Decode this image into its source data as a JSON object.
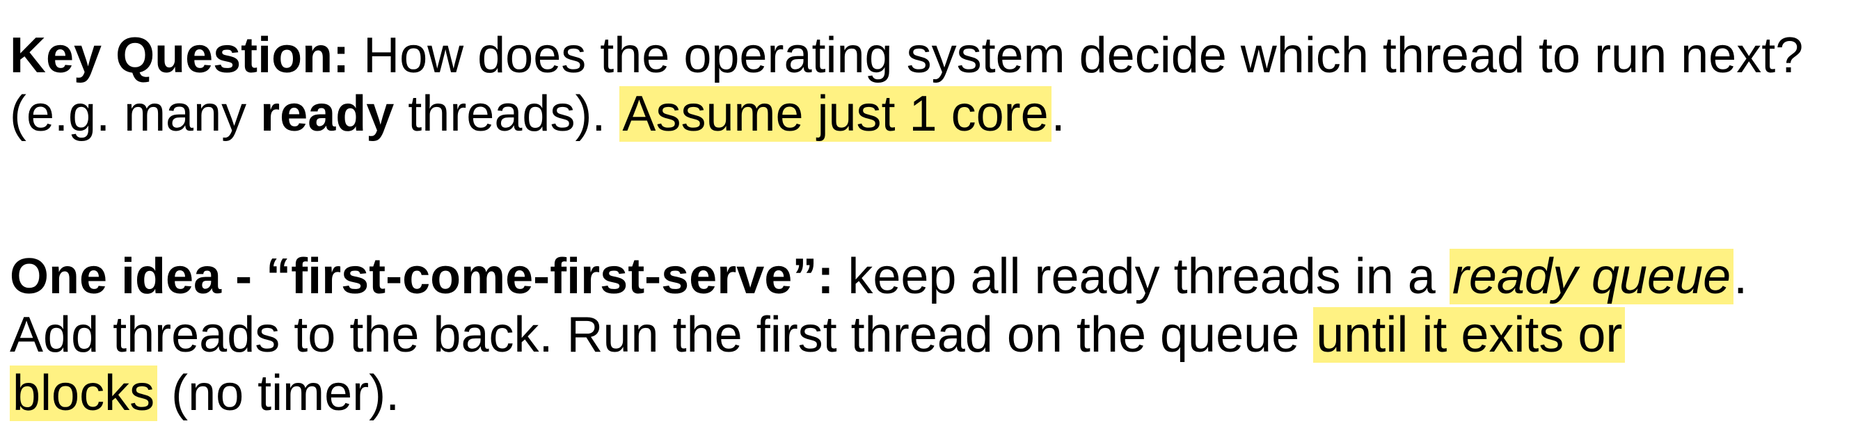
{
  "highlight_color": "#fff283",
  "para1": {
    "line1": {
      "label": "Key Question:",
      "text": " How does the operating system decide which thread to run next?"
    },
    "line2": {
      "pre": "(e.g. many ",
      "bold": "ready",
      "post": " threads).  ",
      "highlight": "Assume just 1 core",
      "end": "."
    }
  },
  "para2": {
    "line1": {
      "label": "One idea - “first-come-first-serve”:",
      "text": " keep all ready threads in a ",
      "highlight_italic": "ready queue",
      "end": "."
    },
    "line2": {
      "text": "Add threads to the back.  Run the first thread on the queue ",
      "highlight": "until it exits or"
    },
    "line3": {
      "highlight": "blocks",
      "text": " (no timer)."
    }
  }
}
